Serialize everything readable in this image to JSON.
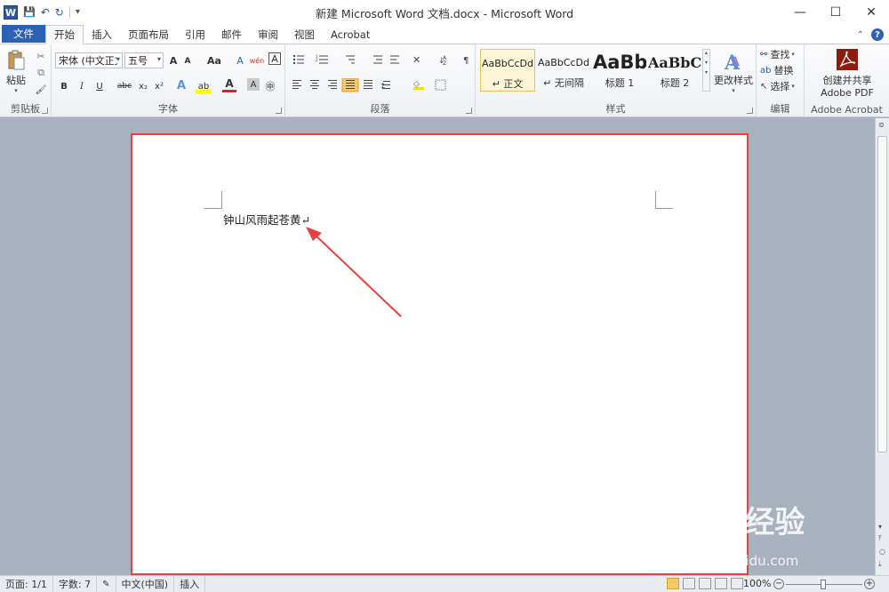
{
  "window": {
    "title": "新建 Microsoft Word 文档.docx - Microsoft Word",
    "app_icon_letter": "W",
    "qat": {
      "save": "💾",
      "undo": "↶",
      "redo": "↻",
      "customize": "▾"
    },
    "controls": {
      "minimize": "—",
      "maximize": "☐",
      "close": "✕"
    }
  },
  "tabs": {
    "file": "文件",
    "home": "开始",
    "insert": "插入",
    "layout": "页面布局",
    "references": "引用",
    "mailings": "邮件",
    "review": "审阅",
    "view": "视图",
    "acrobat": "Acrobat",
    "collapse_icon": "⌃",
    "help_icon": "?"
  },
  "ribbon": {
    "clipboard": {
      "label": "剪贴板",
      "paste": "粘贴",
      "cut": "✂",
      "copy": "⧉",
      "format_painter": "🖌"
    },
    "font": {
      "label": "字体",
      "font_name": "宋体 (中文正文)",
      "font_size": "五号",
      "grow": "A",
      "shrink": "A",
      "change_case": "Aa",
      "clear_format": "A",
      "phonetic": "wén",
      "char_border": "A",
      "bold": "B",
      "italic": "I",
      "underline": "U",
      "strike": "abc",
      "subscript": "x₂",
      "superscript": "x²",
      "text_effect": "A",
      "highlight": "ab",
      "font_color": "A",
      "char_shading": "A",
      "enclose": "㊥"
    },
    "paragraph": {
      "label": "段落"
    },
    "styles": {
      "label": "样式",
      "items": [
        {
          "sample": "AaBbCcDd",
          "name": "↵ 正文"
        },
        {
          "sample": "AaBbCcDd",
          "name": "↵ 无间隔"
        },
        {
          "sample": "AaBb",
          "name": "标题 1"
        },
        {
          "sample": "AaBbC",
          "name": "标题 2"
        }
      ],
      "change_styles": "更改样式"
    },
    "editing": {
      "label": "编辑",
      "find": "查找",
      "replace": "替换",
      "select": "选择"
    },
    "acrobat": {
      "label": "Adobe Acrobat",
      "create_line1": "创建并共享",
      "create_line2": "Adobe PDF"
    }
  },
  "document": {
    "text": "钟山风雨起苍黄↵"
  },
  "statusbar": {
    "page": "页面: 1/1",
    "words": "字数: 7",
    "language": "中文(中国)",
    "mode": "插入",
    "zoom": "100%"
  },
  "watermark": {
    "main": "Bai 经验",
    "sub": "jingyan.baidu.com"
  },
  "colors": {
    "accent": "#2b62b4",
    "highlight_border": "#e8403e",
    "arrow": "#e8403e"
  }
}
